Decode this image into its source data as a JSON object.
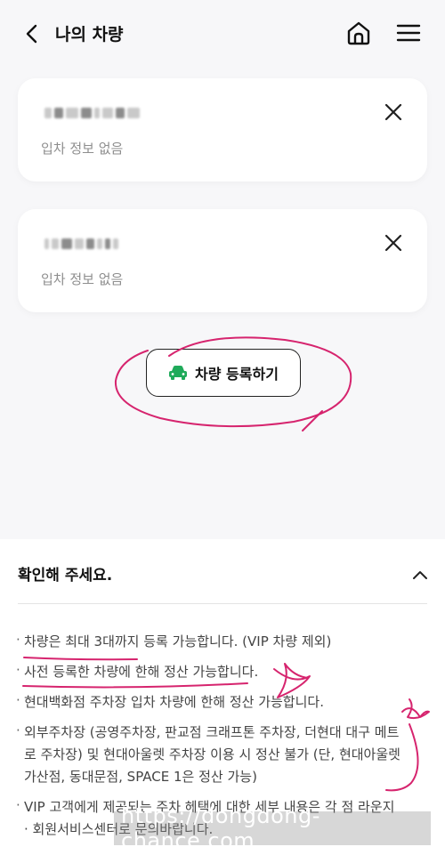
{
  "header": {
    "title": "나의 차량",
    "back_icon": "chevron-left-icon",
    "home_icon": "home-icon",
    "menu_icon": "hamburger-icon"
  },
  "vehicles": [
    {
      "status": "입차 정보 없음"
    },
    {
      "status": "입차 정보 없음"
    }
  ],
  "register_button": {
    "label": "차량 등록하기",
    "icon": "car-icon",
    "icon_color": "#1faa5a"
  },
  "notice": {
    "title": "확인해 주세요.",
    "toggle_icon": "chevron-up-icon",
    "items": [
      "차량은 최대 3대까지 등록 가능합니다. (VIP 차량 제외)",
      "사전 등록한 차량에 한해 정산 가능합니다.",
      "현대백화점 주차장 입차 차량에 한해 정산 가능합니다.",
      "외부주차장 (공영주차장, 판교점 크래프톤 주차장, 더현대 대구 메트로 주차장) 및 현대아울렛 주차장 이용 시 정산 불가 (단, 현대아울렛 가산점, 동대문점, SPACE 1은 정산 가능)",
      "VIP 고객에게 제공되는 주차 혜택에 대한 세부 내용은 각 점 라운지 · 회원서비스센터로 문의바랍니다."
    ]
  },
  "watermark": "https://dongdong-chance.com",
  "colors": {
    "annotation": "#d6246e",
    "background": "#f7f7f9"
  }
}
